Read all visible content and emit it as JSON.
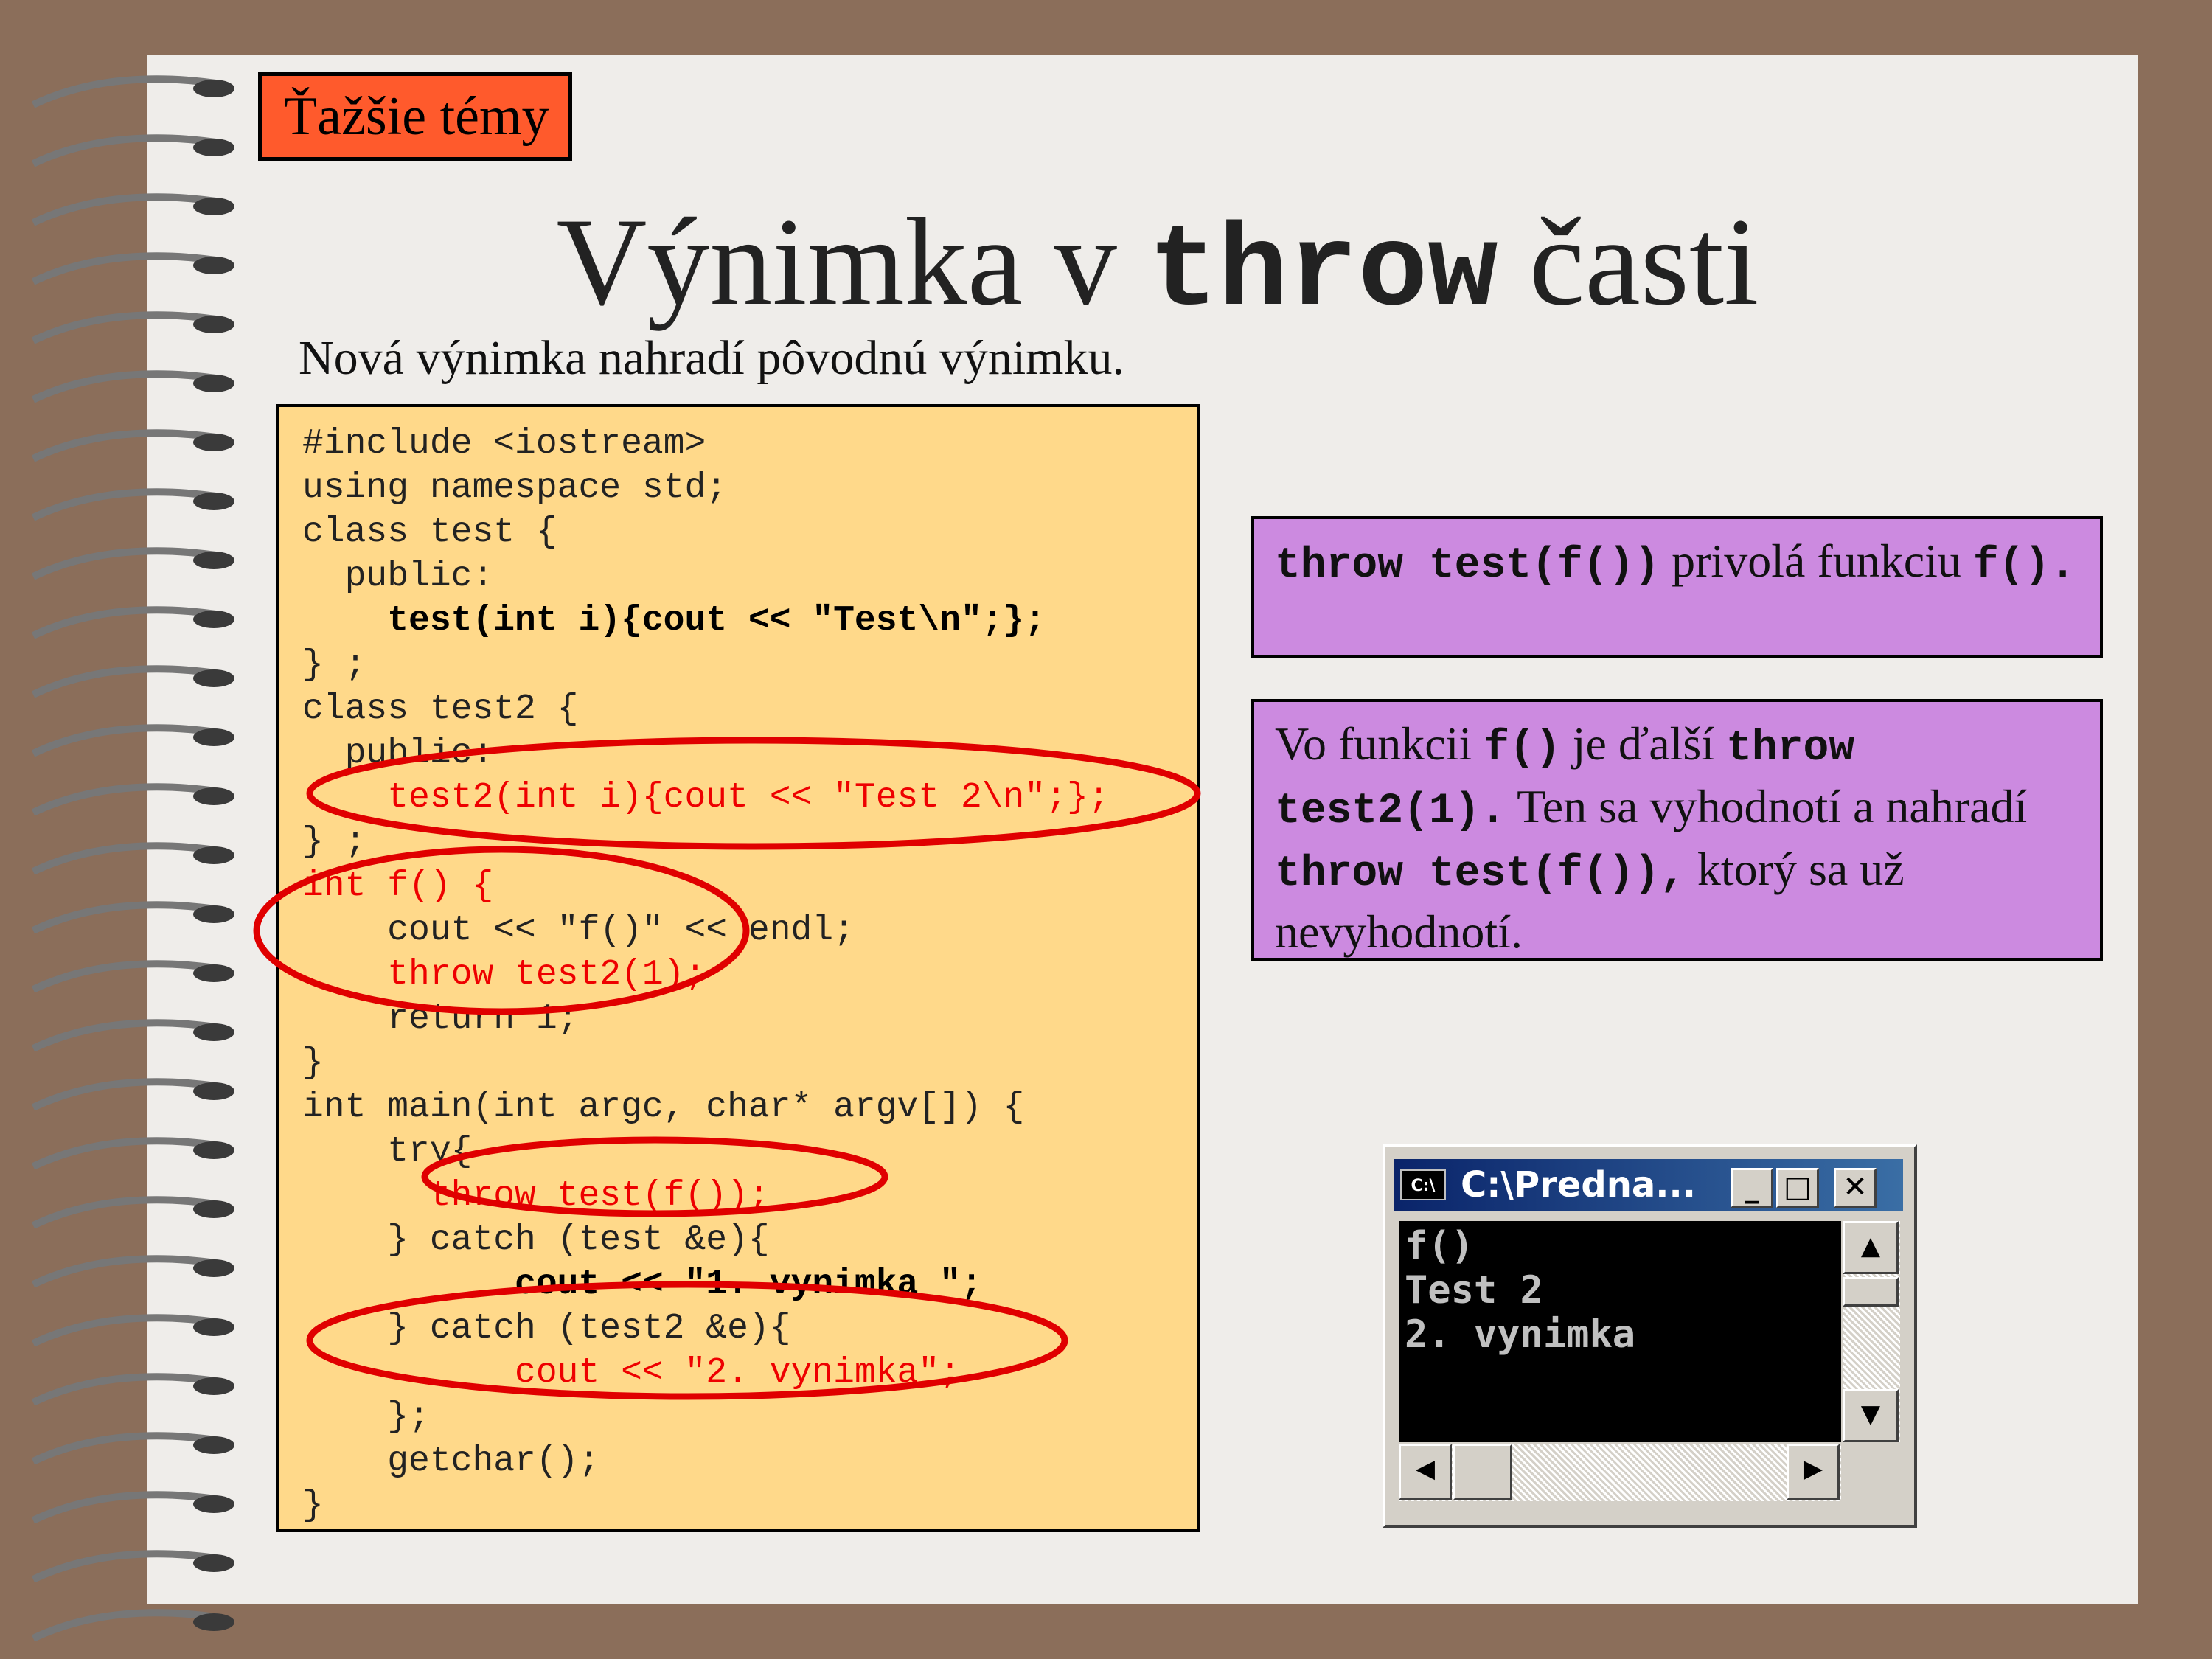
{
  "slide": {
    "tag": "Ťažšie témy",
    "title_before": "Výnimka v ",
    "title_keyword": "throw",
    "title_after": " časti",
    "subtitle": "Nová výnimka nahradí pôvodnú výnimku."
  },
  "code": {
    "lines": [
      "#include <iostream>",
      "using namespace std;",
      "class test {",
      "  public:",
      "    test(int i){cout << \"Test\\n\";};",
      "} ;",
      "class test2 {",
      "  public:",
      "    test2(int i){cout << \"Test 2\\n\";};",
      "} ;",
      "int f() {",
      "    cout << \"f()\" << endl;",
      "    throw test2(1);",
      "    return 1;",
      "}",
      "int main(int argc, char* argv[]) {",
      "    try{",
      "      throw test(f());",
      "    } catch (test &e){",
      "          cout << \"1. vynimka \";",
      "    } catch (test2 &e){",
      "          cout << \"2. vynimka\";",
      "    };",
      "    getchar();",
      "}"
    ]
  },
  "note1": {
    "kw1": "throw test(f())",
    "t1": " privolá funkciu ",
    "kw2": "f().",
    "t2": ""
  },
  "note2": {
    "t1": "Vo funkcii ",
    "kw1": "f()",
    "t2": " je ďalší ",
    "kw2": "throw test2(1).",
    "t3": " Ten sa vyhodnotí a nahradí ",
    "kw3": "throw test(f()),",
    "t4": " ktorý sa už nevyhodnotí."
  },
  "console": {
    "title": "C:\\Predna...",
    "icon_text": "C:\\",
    "output": [
      "f()",
      "Test 2",
      "2. vynimka"
    ],
    "minimize_icon": "minimize-icon",
    "maximize_icon": "maximize-icon",
    "close_icon": "close-icon"
  },
  "colors": {
    "background": "#8b6e5a",
    "paper": "#efedea",
    "tag": "#ff5a2c",
    "code_box": "#ffd98a",
    "note_box": "#cc8ae0",
    "highlight": "#e00000"
  }
}
